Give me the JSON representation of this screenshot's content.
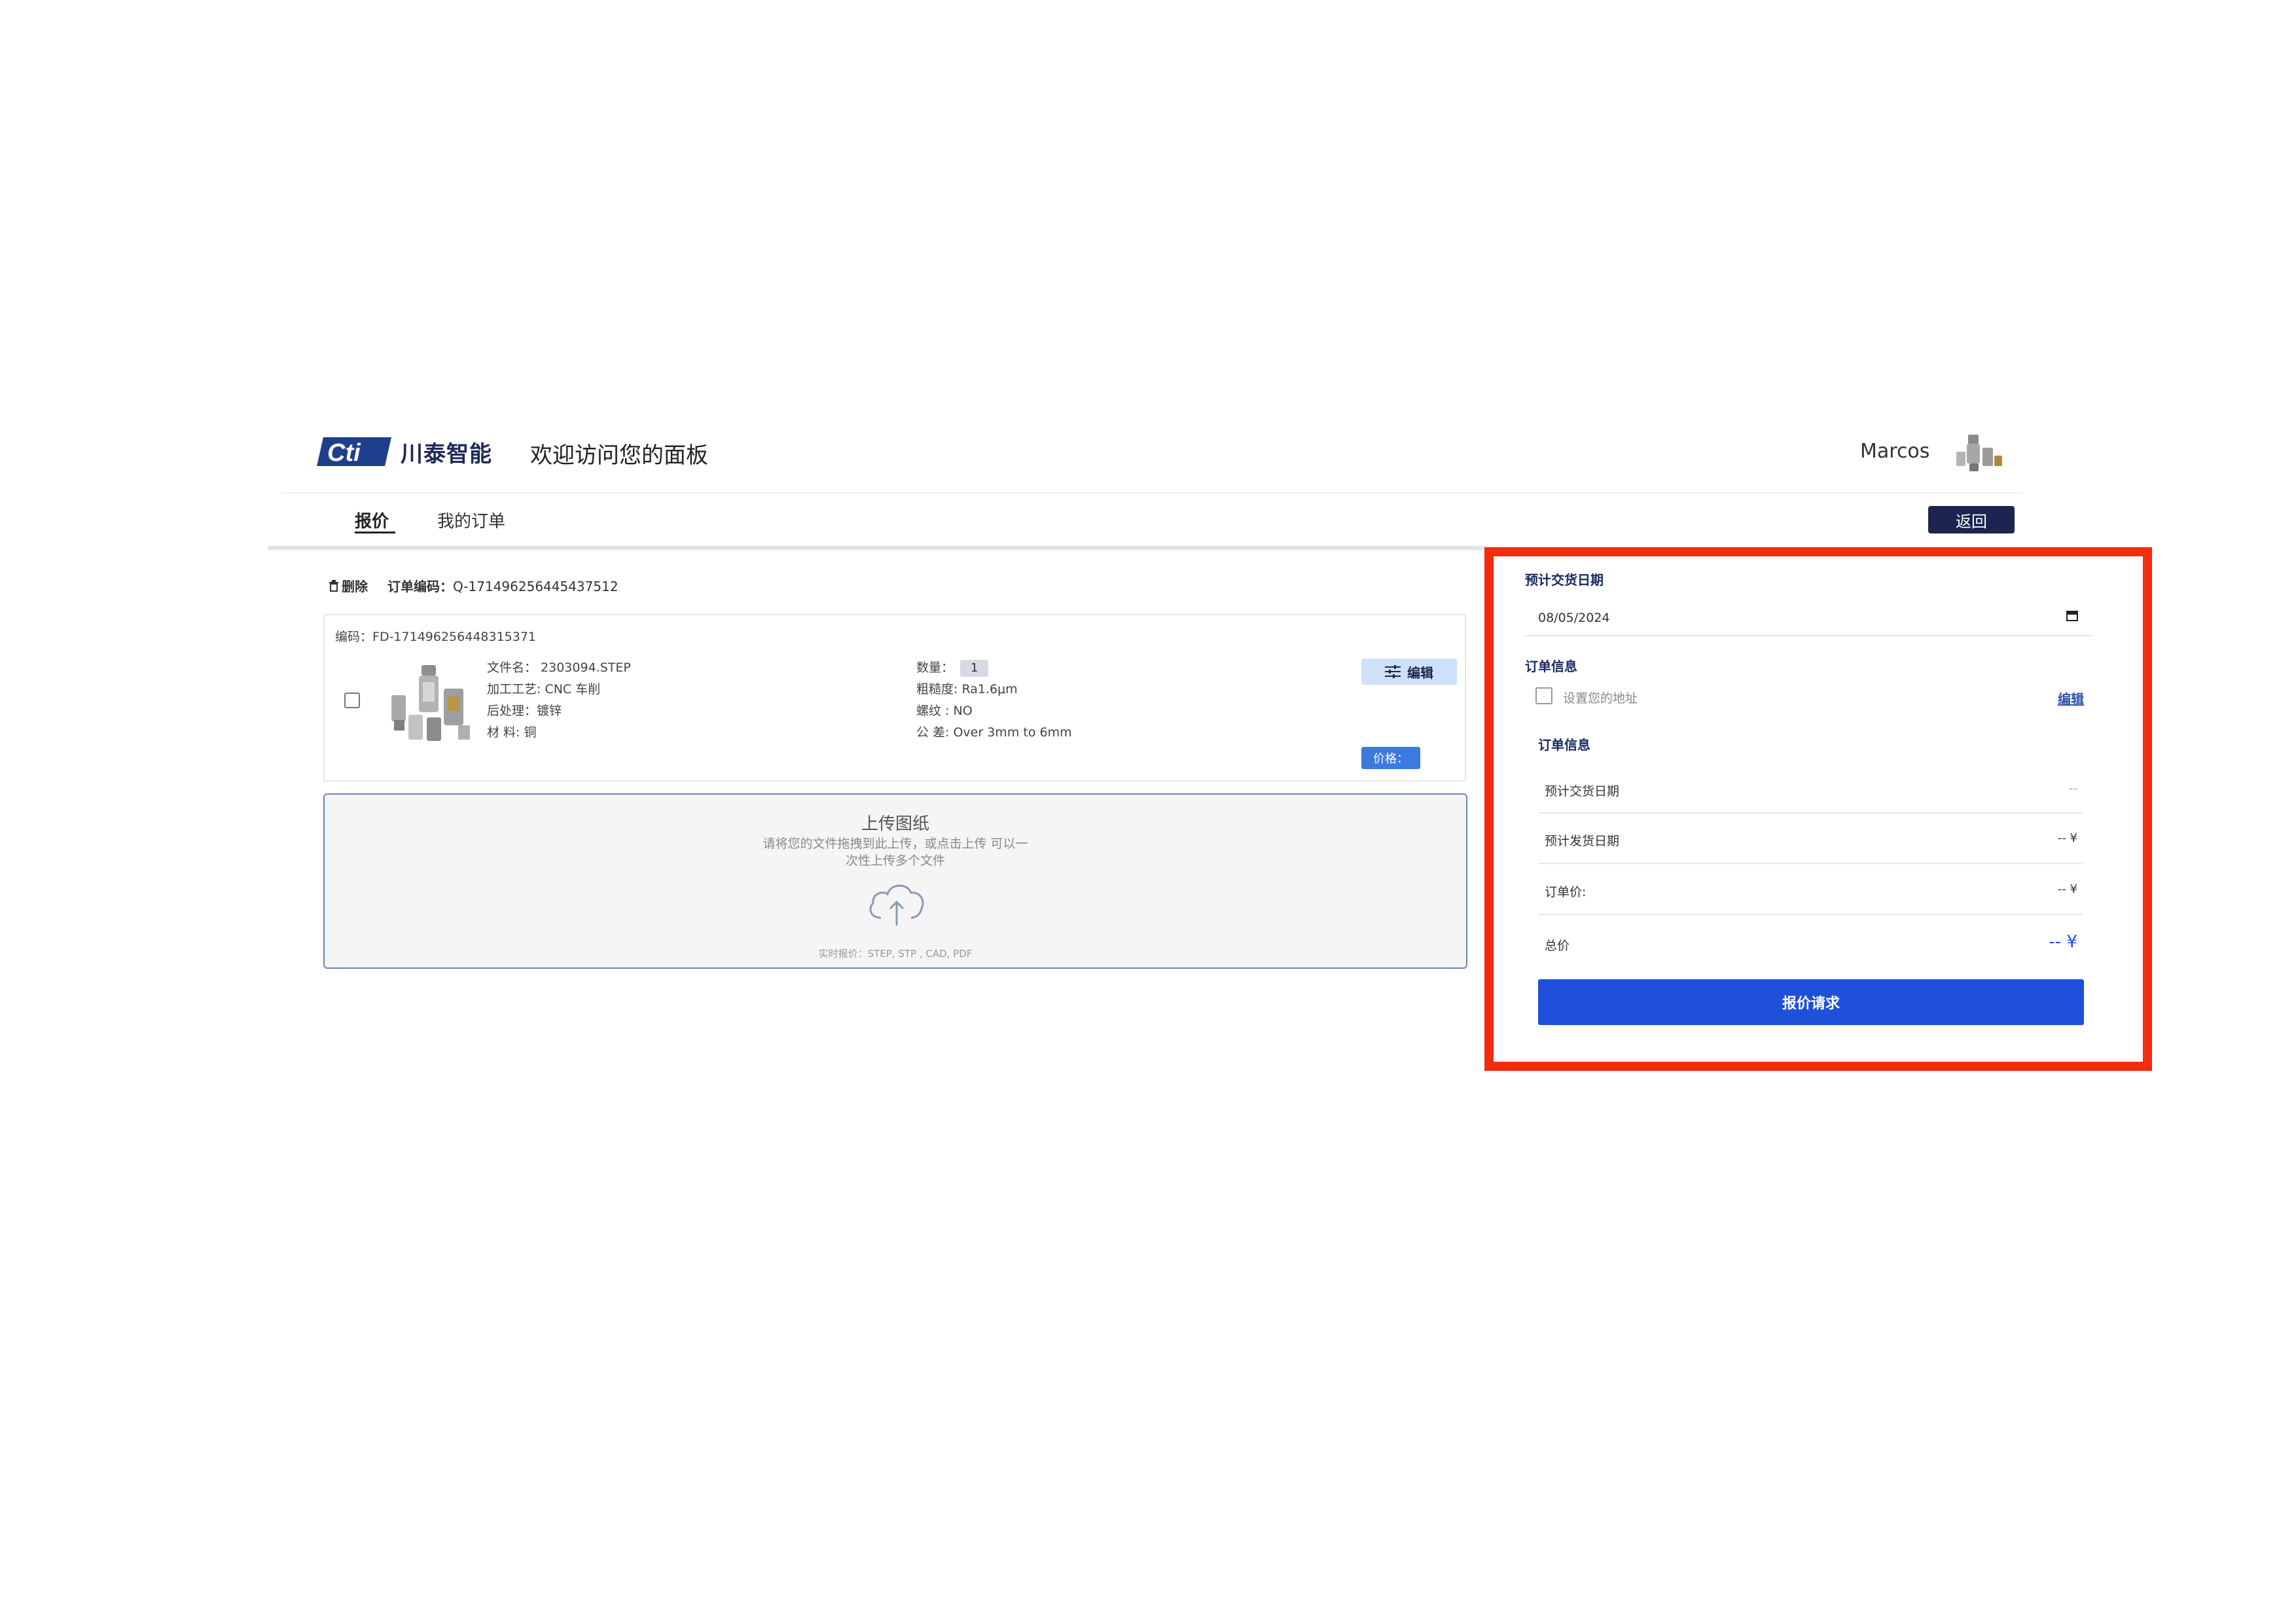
{
  "header": {
    "brand_mark": "Cti",
    "brand_cn": "川泰智能",
    "welcome": "欢迎访问您的面板",
    "user_name": "Marcos"
  },
  "tabs": [
    {
      "label": "报价",
      "active": true
    },
    {
      "label": "我的订单",
      "active": false
    }
  ],
  "back_label": "返回",
  "order": {
    "delete_label": "删除",
    "code_label": "订单编码：",
    "code": "Q-171496256445437512"
  },
  "item": {
    "code_label": "编码：",
    "code": "FD-171496256448315371",
    "file_name": "文件名： 2303094.STEP",
    "process": "加工工艺: CNC 车削",
    "post_process": "后处理：镀锌",
    "material": "材 料: 铜",
    "qty_label": "数量：",
    "qty": "1",
    "roughness": "粗糙度: Ra1.6μm",
    "thread": "螺纹 : NO",
    "tolerance": "公 差: Over 3mm to 6mm",
    "edit_label": "编辑",
    "price_label": "价格："
  },
  "upload": {
    "title": "上传图纸",
    "hint_line1": "请将您的文件拖拽到此上传，或点击上传 可以一",
    "hint_line2": "次性上传多个文件",
    "formats": "实时报价：STEP, STP , CAD, PDF"
  },
  "panel": {
    "date_label": "预计交货日期",
    "date_value": "08/05/2024",
    "order_info_label": "订单信息",
    "address_label": "设置您的地址",
    "edit_link": "编辑",
    "summary_label": "订单信息",
    "rows": [
      {
        "label": "预计交货日期",
        "value": "--"
      },
      {
        "label": "预计发货日期",
        "value": "-- ¥"
      },
      {
        "label": "订单价:",
        "value": "-- ¥"
      },
      {
        "label": "总价",
        "value": "-- ¥"
      }
    ],
    "submit_label": "报价请求"
  },
  "colors": {
    "highlight": "#f42b0f",
    "primary": "#1e50d9",
    "navy": "#1b2550"
  }
}
